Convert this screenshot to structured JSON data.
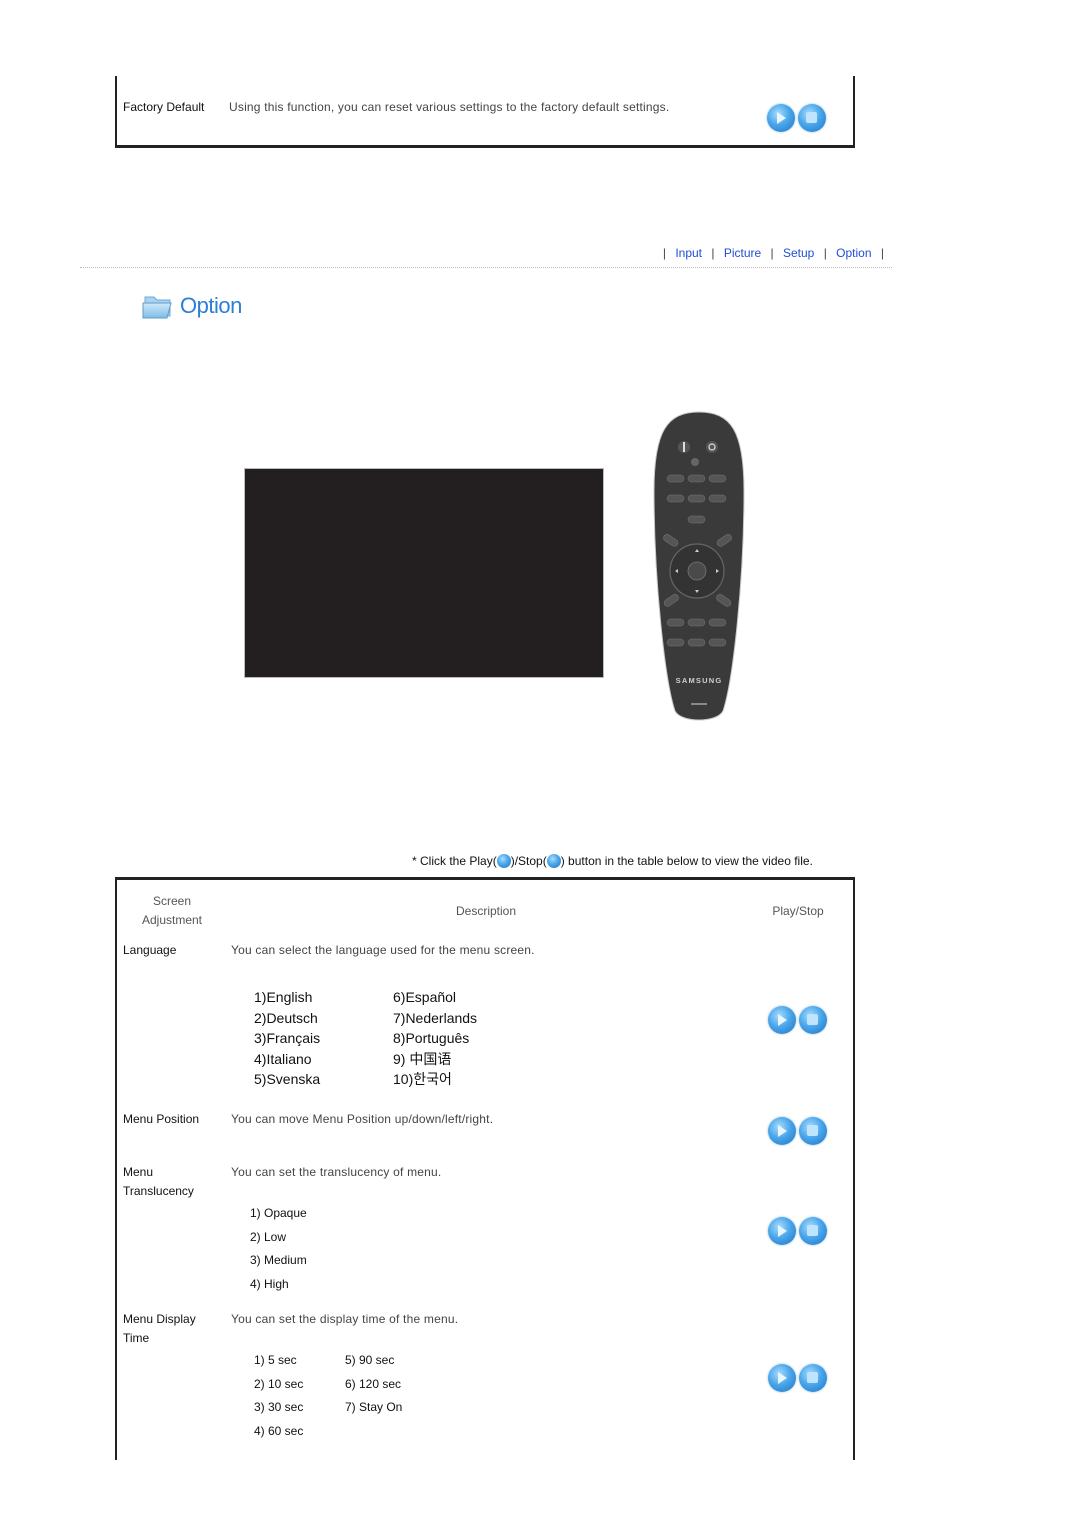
{
  "top_table": {
    "row": {
      "label": "Factory Default",
      "description": "Using this function, you can reset various settings to the factory default settings."
    }
  },
  "nav": {
    "items": [
      {
        "label": "Input"
      },
      {
        "label": "Picture"
      },
      {
        "label": "Setup"
      },
      {
        "label": "Option"
      }
    ],
    "separator": "|"
  },
  "section": {
    "title": "Option",
    "icon": "folder-icon"
  },
  "remote": {
    "brand": "SAMSUNG",
    "icon": "remote-control-image"
  },
  "note": {
    "prefix": "* Click the Play(",
    "middle": ")/Stop(",
    "suffix": ") button in the table below to view the video file."
  },
  "table": {
    "headers": {
      "col1": "Screen Adjustment",
      "col1_line1": "Screen",
      "col1_line2": "Adjustment",
      "col2": "Description",
      "col3": "Play/Stop"
    },
    "rows": [
      {
        "label": "Language",
        "description": "You can select the language used for the menu screen.",
        "options": [
          "1)English",
          "6)Español",
          "2)Deutsch",
          "7)Nederlands",
          "3)Français",
          "8)Português",
          "4)Italiano",
          "9) 中国语",
          "5)Svenska",
          "10)한국어"
        ]
      },
      {
        "label": "Menu Position",
        "description": "You can move Menu Position up/down/left/right."
      },
      {
        "label": "Menu Translucency",
        "label_line1": "Menu",
        "label_line2": "Translucency",
        "description": "You can set the translucency of menu.",
        "options": [
          "1) Opaque",
          "2) Low",
          "3) Medium",
          "4) High"
        ]
      },
      {
        "label": "Menu Display Time",
        "label_line1": "Menu Display",
        "label_line2": "Time",
        "description": "You can set the display time of the menu.",
        "options": [
          "1) 5 sec",
          "5) 90 sec",
          "2) 10 sec",
          "6) 120 sec",
          "3) 30 sec",
          "7) Stay On",
          "4) 60 sec",
          ""
        ]
      }
    ]
  },
  "colors": {
    "link": "#1f4fd3",
    "title": "#2a7fd6",
    "button": "#4aa6ea",
    "screen": "#231f20",
    "remote": "#3a3a3a"
  }
}
